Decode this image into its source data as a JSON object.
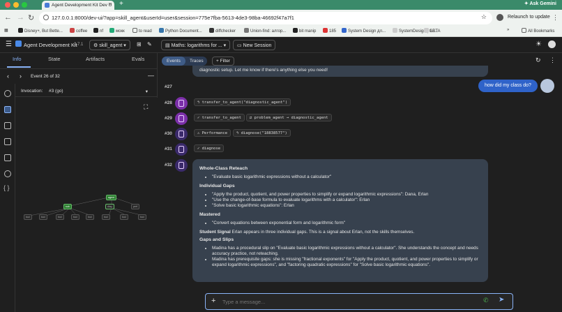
{
  "browser": {
    "tab_title": "Agent Development Kit Dev U",
    "url": "127.0.0.1:8000/dev-ui/?app=skill_agent&userId=user&session=775e7fba-5613-4de3-98ba-46692f47a7f1",
    "relaunch": "Relaunch to update",
    "gemini": "Ask Gemini",
    "bookmarks": [
      "Disney+, But Bette...",
      "coffee",
      "nf",
      "мокк",
      "to read",
      "Python Document...",
      "diffchecker",
      "Union-find: алгор...",
      "bit manip",
      "185",
      "System Design дл...",
      "SystemDesign | Gi...",
      "LBTA"
    ],
    "all_bookmarks": "All Bookmarks"
  },
  "app": {
    "title": "Agent Development Kit",
    "version": "2.7.1",
    "agent": "skill_agent",
    "session_title": "Maths: logarithms for ...",
    "new_session": "New Session",
    "events_tab": "Events",
    "traces_tab": "Traces",
    "filter": "Filter"
  },
  "left": {
    "tabs": [
      "Info",
      "State",
      "Artifacts",
      "Evals"
    ],
    "event_nav": "Event 26 of 32",
    "invocation_label": "Invocation:",
    "invocation_value": "#3 (go)"
  },
  "events": [
    {
      "num": "#27"
    },
    {
      "num": "#28",
      "chips": [
        "transfer_to_agent(\"diagnostic_agent\")"
      ]
    },
    {
      "num": "#29",
      "chips": [
        "transfer_to_agent",
        "problem_agent → diagnostic_agent"
      ]
    },
    {
      "num": "#30",
      "chips": [
        "Performance",
        "diagnose(\"18838577\")"
      ]
    },
    {
      "num": "#31",
      "chips": [
        "diagnose"
      ]
    },
    {
      "num": "#32"
    }
  ],
  "top_text": "diagnostic setup. Let me know if there's anything else you need!",
  "user_msg": "how did my class do?",
  "report": {
    "h1": "Whole-Class Reteach",
    "l1": [
      "\"Evaluate basic logarithmic expressions without a calculator\""
    ],
    "h2": "Individual Gaps",
    "l2": [
      "\"Apply the product, quotient, and power properties to simplify or expand logarithmic expressions\": Dana, Erlan",
      "\"Use the change-of-base formula to evaluate logarithms with a calculator\": Erlan",
      "\"Solve basic logarithmic equations\": Erlan"
    ],
    "h3": "Mastered",
    "l3": [
      "\"Convert equations between exponential form and logarithmic form\""
    ],
    "signal_h": "Student Signal",
    "signal_t": "Erlan appears in three individual gaps. This is a signal about Erlan, not the skills themselves.",
    "h4": "Gaps and Slips",
    "l4": [
      "Madina has a procedural slip on \"Evaluate basic logarithmic expressions without a calculator\". She understands the concept and needs accuracy practice, not reteaching.",
      "Madina has prerequisite gaps: she is missing \"fractional exponents\" for \"Apply the product, quotient, and power properties to simplify or expand logarithmic expressions\", and \"factoring quadratic expressions\" for \"Solve basic logarithmic equations\"."
    ]
  },
  "input": {
    "placeholder": "Type a message..."
  }
}
